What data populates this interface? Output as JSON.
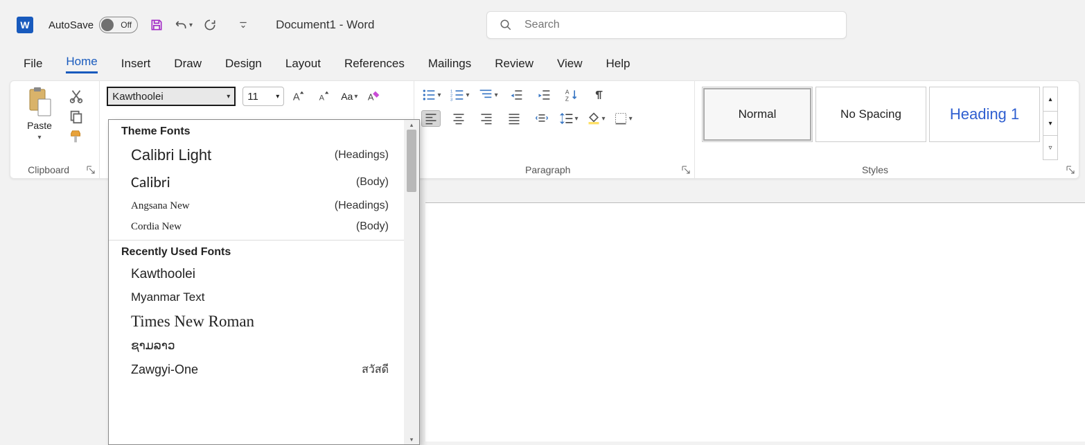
{
  "title": {
    "autosave": "AutoSave",
    "autosave_state": "Off",
    "document": "Document1  -  Word"
  },
  "search": {
    "placeholder": "Search"
  },
  "tabs": [
    "File",
    "Home",
    "Insert",
    "Draw",
    "Design",
    "Layout",
    "References",
    "Mailings",
    "Review",
    "View",
    "Help"
  ],
  "active_tab": "Home",
  "clipboard": {
    "paste": "Paste",
    "group": "Clipboard"
  },
  "font": {
    "name": "Kawthoolei",
    "size": "11",
    "case": "Aa"
  },
  "paragraph": {
    "group": "Paragraph"
  },
  "styles": {
    "group": "Styles",
    "normal": "Normal",
    "nospace": "No Spacing",
    "heading1": "Heading 1"
  },
  "fontdropdown": {
    "theme_heading": "Theme Fonts",
    "theme_fonts": [
      {
        "name": "Calibri Light",
        "tag": "(Headings)"
      },
      {
        "name": "Calibri",
        "tag": "(Body)"
      },
      {
        "name": "Angsana New",
        "tag": "(Headings)"
      },
      {
        "name": "Cordia New",
        "tag": "(Body)"
      }
    ],
    "recent_heading": "Recently Used Fonts",
    "recent_fonts": [
      {
        "name": "Kawthoolei",
        "tag": ""
      },
      {
        "name": "Myanmar Text",
        "tag": ""
      },
      {
        "name": "Times New Roman",
        "tag": ""
      },
      {
        "name": "ຊາມລາວ",
        "tag": ""
      },
      {
        "name": "Zawgyi-One",
        "tag": "สวัสดี"
      }
    ]
  }
}
